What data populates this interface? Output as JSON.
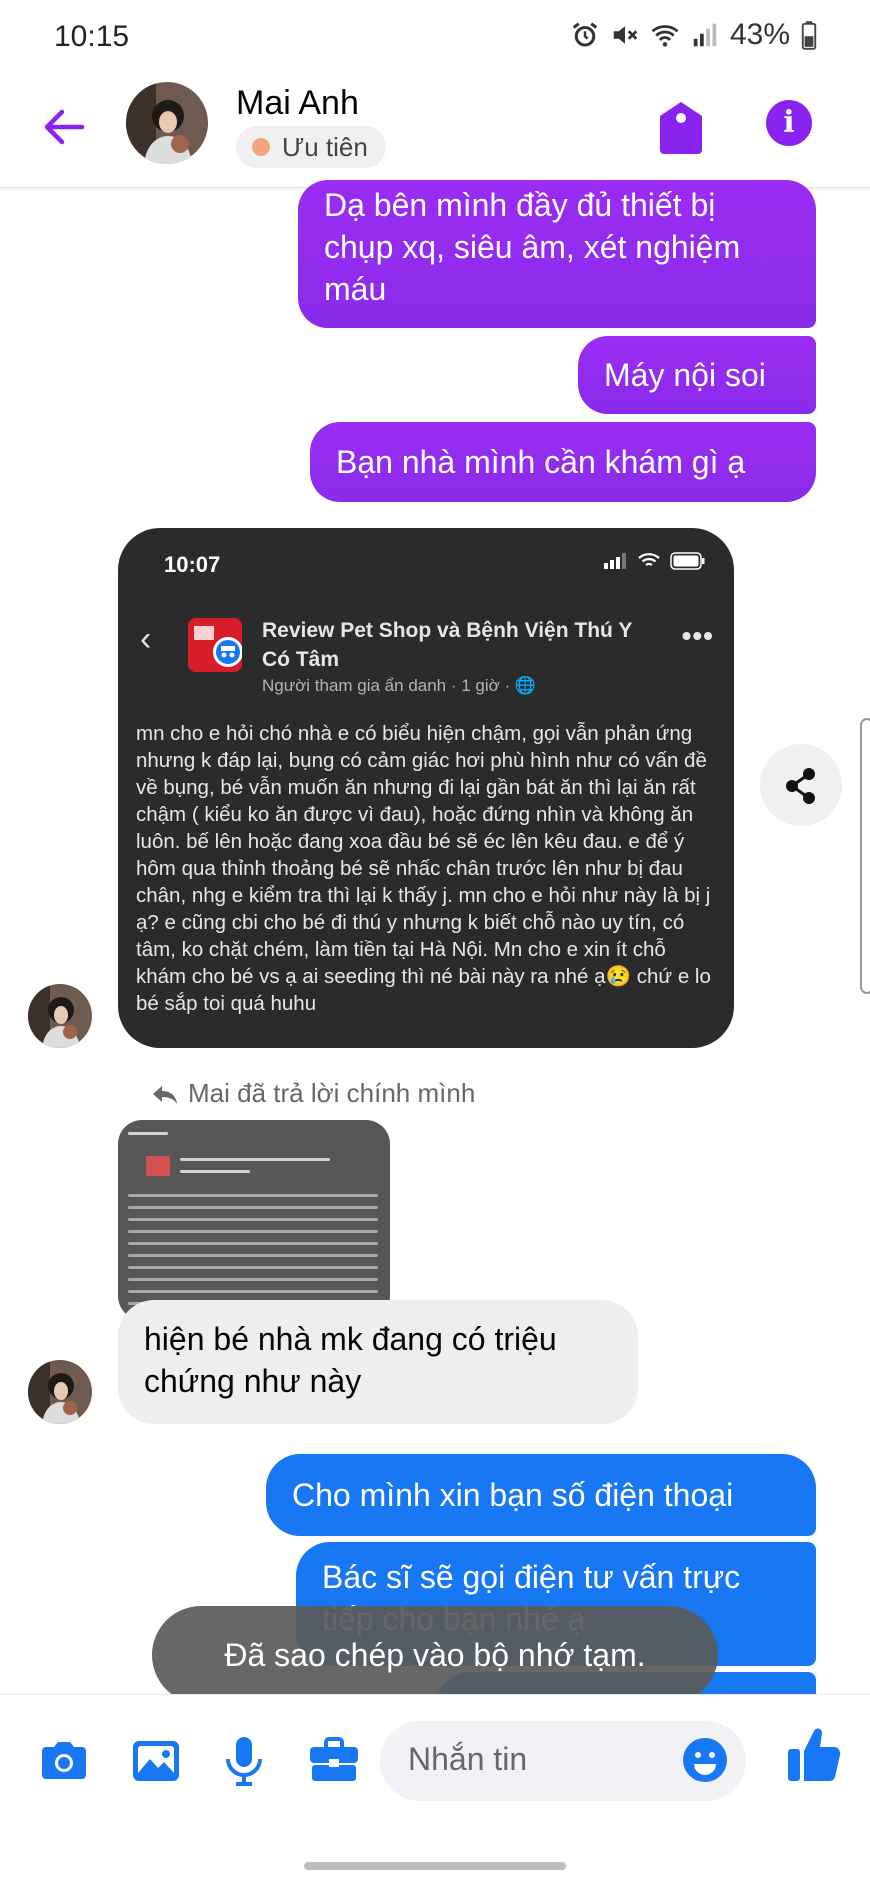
{
  "status_bar": {
    "time": "10:15",
    "battery": "43%",
    "icons": [
      "alarm-icon",
      "mute-icon",
      "wifi-icon",
      "signal-icon",
      "battery-icon"
    ]
  },
  "header": {
    "contact_name": "Mai Anh",
    "priority_label": "Ưu tiên",
    "accent_color": "#8a22f0"
  },
  "messages": {
    "outgoing_1": "Dạ bên mình đầy đủ thiết bị chụp xq, siêu âm, xét nghiệm máu",
    "outgoing_2": "Máy nội soi",
    "outgoing_3": "Bạn nhà mình cần khám gì ạ",
    "reply_label": "Mai đã trả lời chính mình",
    "incoming_1": "hiện bé nhà mk đang có triệu chứng như này",
    "outgoing_4": "Cho mình xin bạn số điện thoại",
    "outgoing_5": "Bác sĩ sẽ gọi điện tư vấn trực tiếp cho bạn nhé ạ"
  },
  "shared_screenshot": {
    "time": "10:07",
    "group_title": "Review Pet Shop và Bệnh Viện Thú Y Có Tâm",
    "meta": "Người tham gia ẩn danh · 1 giờ ·",
    "post_text": "mn cho e hỏi chó nhà e có biểu hiện chậm, gọi vẫn phản ứng nhưng k đáp lại, bụng có cảm giác hơi phù hình như có vấn đề về bụng, bé vẫn muốn ăn nhưng đi lại gần bát ăn thì lại ăn rất chậm ( kiểu ko ăn được vì đau), hoặc đứng nhìn và không ăn luôn. bế lên hoặc đang xoa đầu bé sẽ éc lên kêu đau. e để ý hôm qua thỉnh thoảng bé sẽ nhấc chân trước lên như bị đau chân, nhg e kiểm tra thì lại k thấy j. mn cho e hỏi như này là bị j ạ? e cũng cbi cho bé đi thú y nhưng k biết chỗ nào uy tín, có tâm, ko chặt chém, làm tiền tại Hà Nội. Mn cho e xin ít chỗ khám cho bé vs ạ ai seeding thì né bài này ra nhé ạ😢 chứ e lo bé sắp toi quá huhu"
  },
  "toast": "Đã sao chép vào bộ nhớ tạm.",
  "composer": {
    "placeholder": "Nhắn tin",
    "buttons": [
      "camera-icon",
      "gallery-icon",
      "microphone-icon",
      "briefcase-icon",
      "emoji-icon",
      "thumbs-up-icon"
    ],
    "accent_color": "#1877f2"
  }
}
